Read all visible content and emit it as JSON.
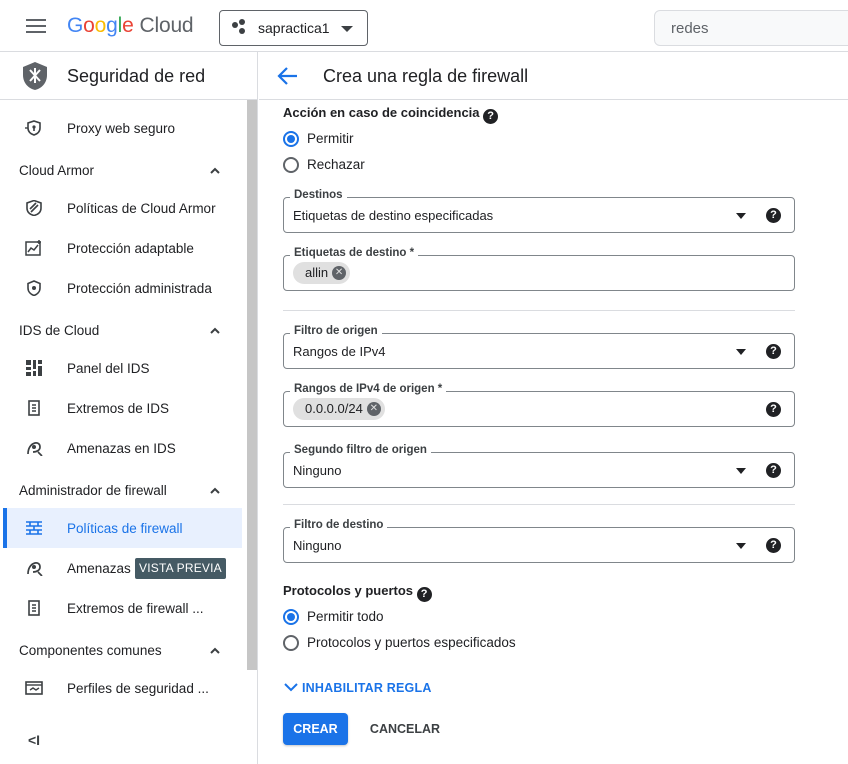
{
  "topbar": {
    "logo_google": "Google",
    "logo_cloud": "Cloud",
    "project": "sapractica1",
    "search_placeholder": "redes"
  },
  "sidebar": {
    "title": "Seguridad de red",
    "items": [
      {
        "label": "Proxy web seguro",
        "icon": "proxy-icon"
      },
      {
        "label": "Cloud Armor",
        "section": true
      },
      {
        "label": "Políticas de Cloud Armor",
        "icon": "armor-policy-icon"
      },
      {
        "label": "Protección adaptable",
        "icon": "adaptive-protection-icon"
      },
      {
        "label": "Protección administrada",
        "icon": "managed-protection-icon"
      },
      {
        "label": "IDS de Cloud",
        "section": true
      },
      {
        "label": "Panel del IDS",
        "icon": "dashboard-icon"
      },
      {
        "label": "Extremos de IDS",
        "icon": "endpoint-icon"
      },
      {
        "label": "Amenazas en IDS",
        "icon": "threats-icon"
      },
      {
        "label": "Administrador de firewall",
        "section": true
      },
      {
        "label": "Políticas de firewall",
        "icon": "firewall-icon",
        "active": true
      },
      {
        "label": "Amenazas",
        "icon": "threats-icon",
        "badge": "VISTA PREVIA"
      },
      {
        "label": "Extremos de firewall ...",
        "icon": "endpoint-icon"
      },
      {
        "label": "Componentes comunes",
        "section": true
      },
      {
        "label": "Perfiles de seguridad ...",
        "icon": "security-profile-icon"
      }
    ],
    "collapse_glyph": "<I"
  },
  "main": {
    "title": "Crea una regla de firewall",
    "match_action": {
      "label": "Acción en caso de coincidencia",
      "options": [
        "Permitir",
        "Rechazar"
      ],
      "selected": "Permitir"
    },
    "targets": {
      "legend": "Destinos",
      "value": "Etiquetas de destino especificadas"
    },
    "target_tags": {
      "legend": "Etiquetas de destino *",
      "chip": "allin"
    },
    "source_filter": {
      "legend": "Filtro de origen",
      "value": "Rangos de IPv4"
    },
    "source_ranges": {
      "legend": "Rangos de IPv4 de origen *",
      "chip": "0.0.0.0/24"
    },
    "second_source_filter": {
      "legend": "Segundo filtro de origen",
      "value": "Ninguno"
    },
    "dest_filter": {
      "legend": "Filtro de destino",
      "value": "Ninguno"
    },
    "protocols": {
      "label": "Protocolos y puertos",
      "options": [
        "Permitir todo",
        "Protocolos y puertos especificados"
      ],
      "selected": "Permitir todo"
    },
    "disable_rule": "INHABILITAR REGLA",
    "create": "CREAR",
    "cancel": "CANCELAR"
  },
  "colors": {
    "accent": "#1a73e8",
    "badge": "#455a64"
  }
}
